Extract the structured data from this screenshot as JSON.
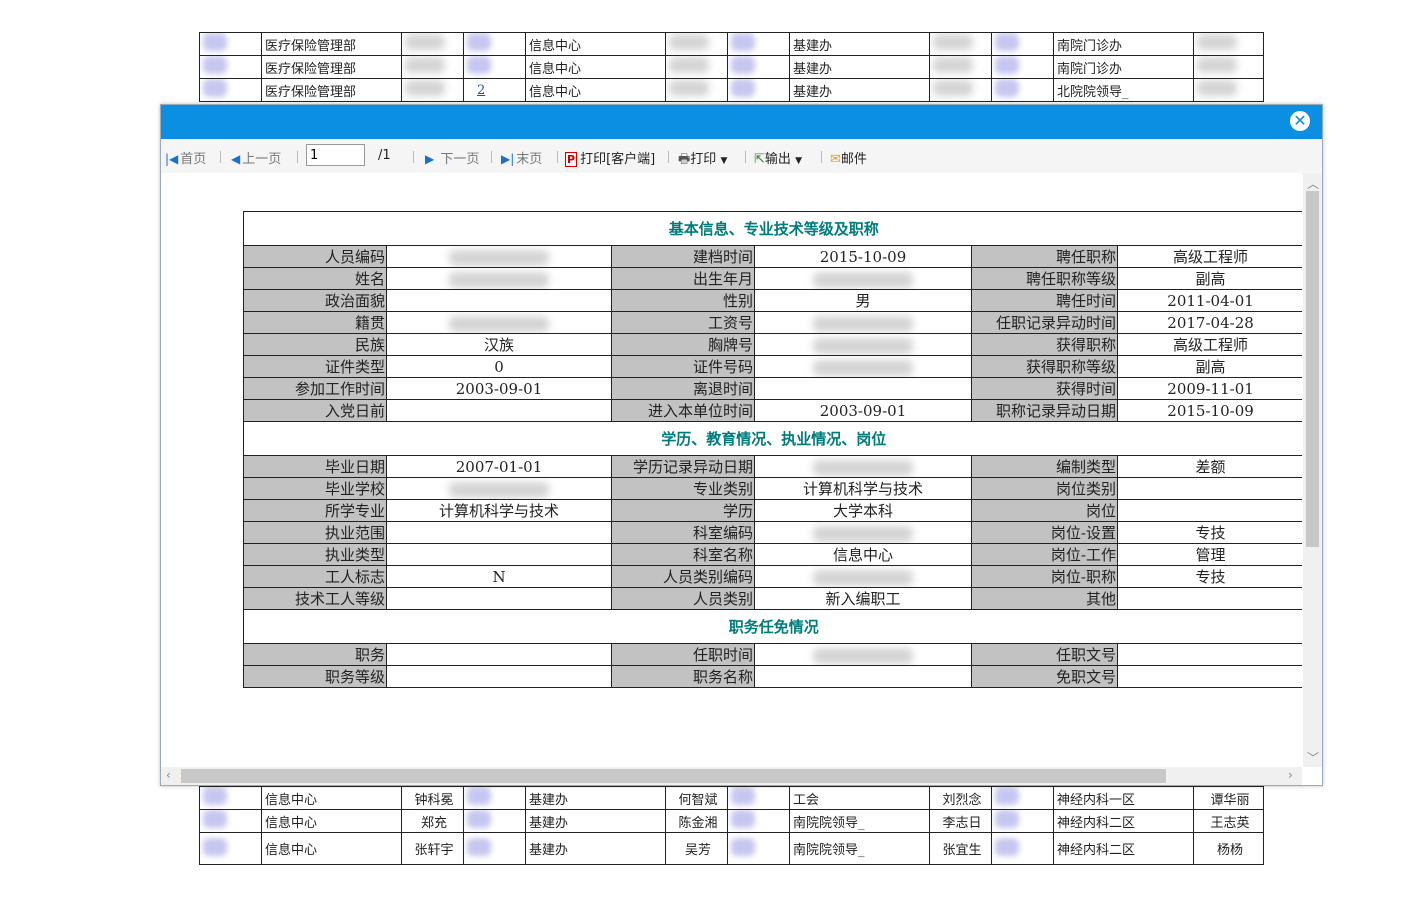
{
  "bg_top": [
    [
      "医疗保险管理部",
      "信息中心",
      "基建办",
      "南院门诊办"
    ],
    [
      "医疗保险管理部",
      "信息中心",
      "基建办",
      "南院门诊办"
    ],
    [
      "医疗保险管理部",
      "信息中心",
      "基建办",
      "北院院领导_"
    ]
  ],
  "bg_bottom": [
    [
      "信息中心",
      "钟科冕",
      "基建办",
      "何智斌",
      "工会",
      "刘烈念",
      "神经内科一区",
      "谭华丽"
    ],
    [
      "信息中心",
      "郑充",
      "基建办",
      "陈金湘",
      "南院院领导_",
      "李志日",
      "神经内科二区",
      "王志英"
    ],
    [
      "信息中心",
      "张轩宇",
      "基建办",
      "吴芳",
      "南院院领导_",
      "张宜生",
      "神经内科二区",
      "杨杨"
    ]
  ],
  "bg_link": "2",
  "toolbar": {
    "first": "首页",
    "prev": "上一页",
    "page_value": "1",
    "page_total": "/1",
    "next": "下一页",
    "last": "末页",
    "print_client": "打印[客户端]",
    "print": "打印",
    "export": "输出",
    "mail": "邮件"
  },
  "report": {
    "sec1": "基本信息、专业技术等级及职称",
    "sec2": "学历、教育情况、执业情况、岗位",
    "sec3": "职务任免情况",
    "rows1": [
      [
        "人员编码",
        "",
        "建档时间",
        "2015-10-09",
        "聘任职称",
        "高级工程师"
      ],
      [
        "姓名",
        "",
        "出生年月",
        "",
        "聘任职称等级",
        "副高"
      ],
      [
        "政治面貌",
        "",
        "性别",
        "男",
        "聘任时间",
        "2011-04-01"
      ],
      [
        "籍贯",
        "",
        "工资号",
        "",
        "任职记录异动时间",
        "2017-04-28"
      ],
      [
        "民族",
        "汉族",
        "胸牌号",
        "",
        "获得职称",
        "高级工程师"
      ],
      [
        "证件类型",
        "0",
        "证件号码",
        "",
        "获得职称等级",
        "副高"
      ],
      [
        "参加工作时间",
        "2003-09-01",
        "离退时间",
        "",
        "获得时间",
        "2009-11-01"
      ],
      [
        "入党日前",
        "",
        "进入本单位时间",
        "2003-09-01",
        "职称记录异动日期",
        "2015-10-09"
      ]
    ],
    "rows2": [
      [
        "毕业日期",
        "2007-01-01",
        "学历记录异动日期",
        "",
        "编制类型",
        "差额"
      ],
      [
        "毕业学校",
        "",
        "专业类别",
        "计算机科学与技术",
        "岗位类别",
        ""
      ],
      [
        "所学专业",
        "计算机科学与技术",
        "学历",
        "大学本科",
        "岗位",
        ""
      ],
      [
        "执业范围",
        "",
        "科室编码",
        "",
        "岗位-设置",
        "专技"
      ],
      [
        "执业类型",
        "",
        "科室名称",
        "信息中心",
        "岗位-工作",
        "管理"
      ],
      [
        "工人标志",
        "N",
        "人员类别编码",
        "",
        "岗位-职称",
        "专技"
      ],
      [
        "技术工人等级",
        "",
        "人员类别",
        "新入编职工",
        "其他",
        ""
      ]
    ],
    "rows3": [
      [
        "职务",
        "",
        "任职时间",
        "",
        "任职文号",
        ""
      ],
      [
        "职务等级",
        "",
        "职务名称",
        "",
        "免职文号",
        ""
      ]
    ]
  },
  "colors": {
    "header_bar": "#0a8fe3",
    "label_bg": "#c2c2c2",
    "section_text": "#007b7b"
  }
}
